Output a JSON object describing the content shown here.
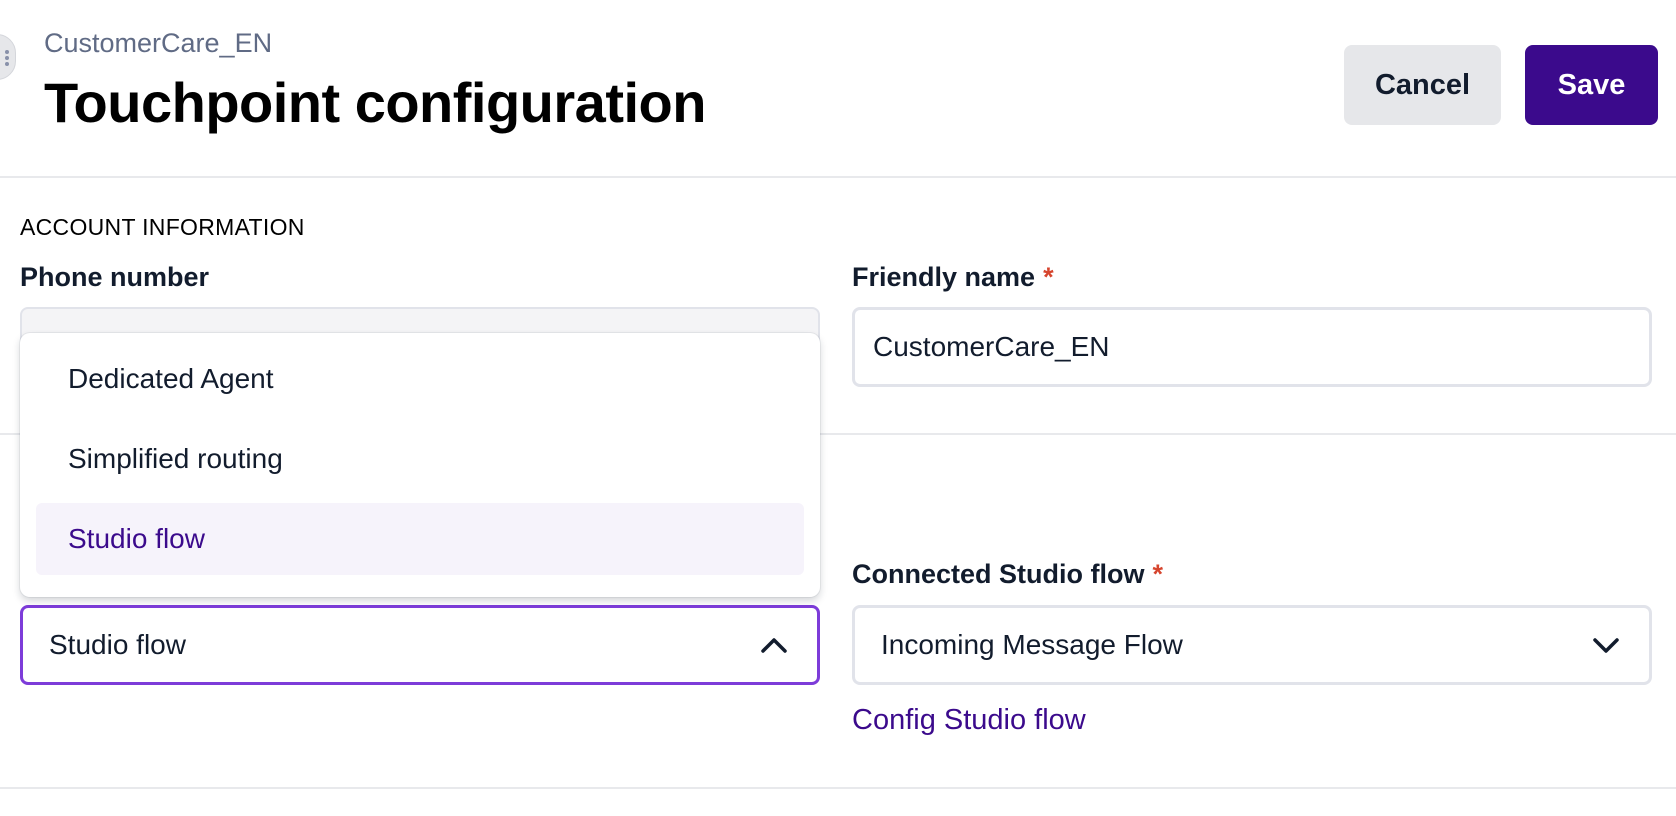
{
  "header": {
    "breadcrumb": "CustomerCare_EN",
    "title": "Touchpoint configuration",
    "cancel_label": "Cancel",
    "save_label": "Save"
  },
  "account": {
    "section_heading": "ACCOUNT INFORMATION",
    "phone_label": "Phone number",
    "phone_value": "",
    "friendly_label": "Friendly name",
    "friendly_required": "*",
    "friendly_value": "CustomerCare_EN"
  },
  "routing": {
    "selected_value": "Studio flow",
    "options": [
      {
        "label": "Dedicated Agent",
        "selected": false
      },
      {
        "label": "Simplified routing",
        "selected": false
      },
      {
        "label": "Studio flow",
        "selected": true
      }
    ]
  },
  "studio": {
    "label": "Connected Studio flow",
    "required": "*",
    "selected_value": "Incoming Message Flow",
    "config_link": "Config Studio flow"
  },
  "colors": {
    "brand": "#3b0a8c",
    "focus_border": "#7d3cd9",
    "required": "#d6452e"
  },
  "icons": {
    "routing_chevron": "chevron-up-icon",
    "flow_chevron": "chevron-down-icon"
  }
}
